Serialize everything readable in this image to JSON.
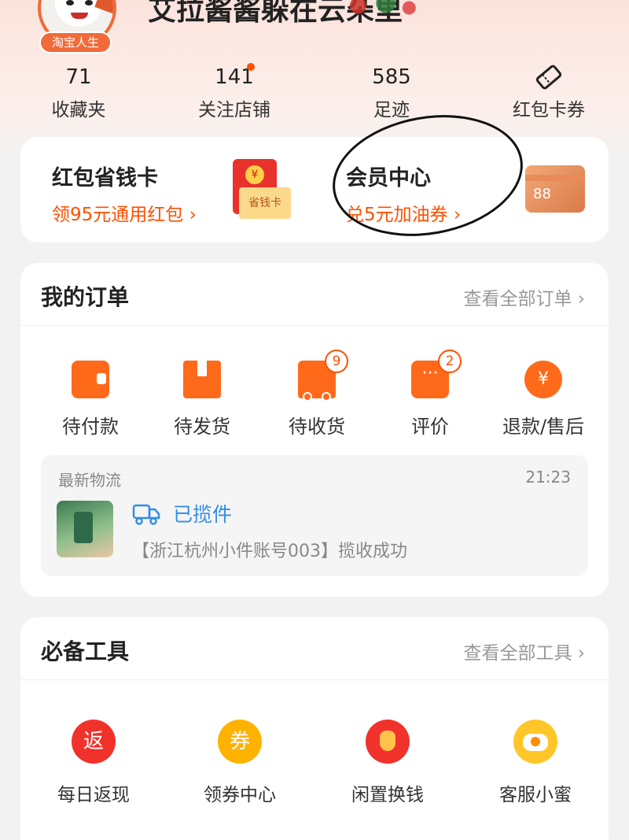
{
  "profile": {
    "username": "艾拉酱酱躲在云朵里",
    "level_badge": "淘宝人生"
  },
  "stats": [
    {
      "value": "71",
      "label": "收藏夹"
    },
    {
      "value": "141",
      "label": "关注店铺",
      "has_dot": true
    },
    {
      "value": "585",
      "label": "足迹"
    },
    {
      "value": "",
      "label": "红包卡券",
      "icon": "ticket-icon"
    }
  ],
  "promo": {
    "left": {
      "title": "红包省钱卡",
      "subtitle": "领95元通用红包 ›",
      "icon_text_coin": "¥",
      "icon_text_card": "省钱卡"
    },
    "right": {
      "title": "会员中心",
      "subtitle": "兑5元加油券 ›",
      "icon_text": "88"
    }
  },
  "orders": {
    "title": "我的订单",
    "link": "查看全部订单 ›",
    "items": [
      {
        "label": "待付款",
        "icon": "wallet-icon"
      },
      {
        "label": "待发货",
        "icon": "box-icon"
      },
      {
        "label": "待收货",
        "icon": "truck-icon",
        "badge": "9"
      },
      {
        "label": "评价",
        "icon": "chat-icon",
        "badge": "2"
      },
      {
        "label": "退款/售后",
        "icon": "refund-icon",
        "glyph": "¥"
      }
    ],
    "logistics": {
      "title": "最新物流",
      "time": "21:23",
      "status": "已揽件",
      "detail": "【浙江杭州小件账号003】揽收成功"
    }
  },
  "tools": {
    "title": "必备工具",
    "link": "查看全部工具 ›",
    "items": [
      {
        "label": "每日返现",
        "glyph": "返",
        "icon": "cashback-icon"
      },
      {
        "label": "领券中心",
        "glyph": "券",
        "icon": "coupon-icon"
      },
      {
        "label": "闲置换钱",
        "glyph": "",
        "icon": "money-bag-icon"
      },
      {
        "label": "客服小蜜",
        "glyph": "",
        "icon": "service-bee-icon"
      }
    ]
  },
  "colors": {
    "accent": "#ff5000",
    "logistics_blue": "#2f8ee6"
  }
}
